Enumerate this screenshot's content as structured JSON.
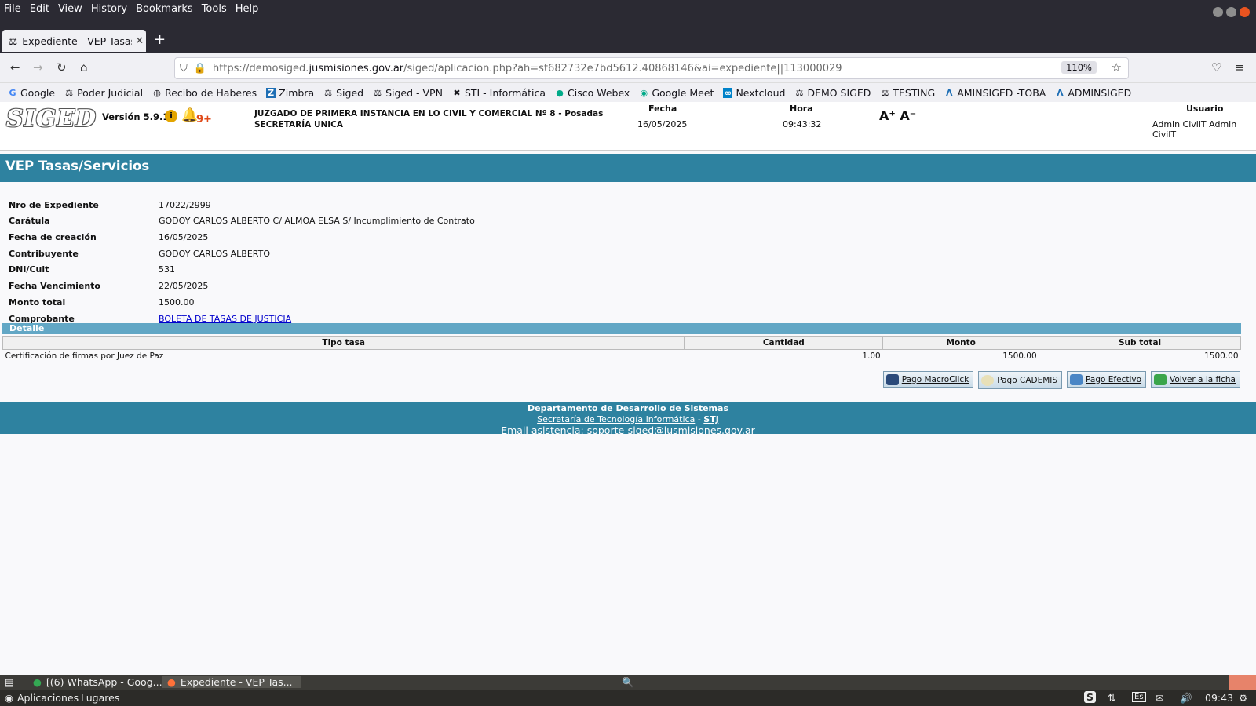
{
  "browser": {
    "menu": [
      "File",
      "Edit",
      "View",
      "History",
      "Bookmarks",
      "Tools",
      "Help"
    ],
    "tab_title": "Expediente - VEP Tasas/S",
    "url_prefix": "https://demosiged.",
    "url_host": "jusmisiones.gov.ar",
    "url_path": "/siged/aplicacion.php?ah=st682732e7bd5612.40868146&ai=expediente||113000029",
    "zoom": "110%",
    "bookmarks": [
      "Google",
      "Poder Judicial",
      "Recibo de Haberes",
      "Zimbra",
      "Siged",
      "Siged - VPN",
      "STI - Informática",
      "Cisco Webex",
      "Google Meet",
      "Nextcloud",
      "DEMO SIGED",
      "TESTING",
      "AMINSIGED -TOBA",
      "ADMINSIGED"
    ]
  },
  "header": {
    "logo": "SIGED",
    "version": "Versión 5.9.1",
    "notif_count": "9+",
    "court_line1": "JUZGADO DE PRIMERA INSTANCIA EN LO CIVIL Y COMERCIAL Nº 8 - Posadas",
    "court_line2": "SECRETARÍA UNICA",
    "fecha_label": "Fecha",
    "fecha": "16/05/2025",
    "hora_label": "Hora",
    "hora": "09:43:32",
    "font_up": "A⁺",
    "font_down": "A⁻",
    "usuario_label": "Usuario",
    "usuario": "Admin CivilT Admin CivilT"
  },
  "title": "VEP Tasas/Servicios",
  "fields": [
    {
      "label": "Nro de Expediente",
      "value": "17022/2999"
    },
    {
      "label": "Carátula",
      "value": "GODOY CARLOS ALBERTO C/ ALMOA ELSA S/ Incumplimiento de Contrato"
    },
    {
      "label": "Fecha de creación",
      "value": "16/05/2025"
    },
    {
      "label": "Contribuyente",
      "value": "GODOY CARLOS ALBERTO"
    },
    {
      "label": "DNI/Cuit",
      "value": "531"
    },
    {
      "label": "Fecha Vencimiento",
      "value": "22/05/2025"
    },
    {
      "label": "Monto total",
      "value": "1500.00"
    },
    {
      "label": "Comprobante",
      "value": "BOLETA DE TASAS DE JUSTICIA"
    }
  ],
  "detalle": {
    "label": "Detalle",
    "columns": [
      "Tipo tasa",
      "Cantidad",
      "Monto",
      "Sub total"
    ],
    "rows": [
      [
        "Certificación de firmas por Juez de Paz",
        "1.00",
        "1500.00",
        "1500.00"
      ]
    ]
  },
  "actions": [
    "Pago MacroClick",
    "Pago CADEMIS",
    "Pago Efectivo",
    "Volver a la ficha"
  ],
  "footer": {
    "line1": "Departamento de Desarrollo de Sistemas",
    "link1": "Secretaría de Tecnología Informática",
    "sep": " - ",
    "link2": "STJ",
    "line3": "Email asistencia: soporte-siged@jusmisiones.gov.ar"
  },
  "taskbar": {
    "task1": "[(6) WhatsApp - Goog...",
    "task2": "Expediente - VEP Tas...",
    "apps": "Aplicaciones",
    "places": "Lugares",
    "lang": "Es",
    "clock": "09:43"
  }
}
